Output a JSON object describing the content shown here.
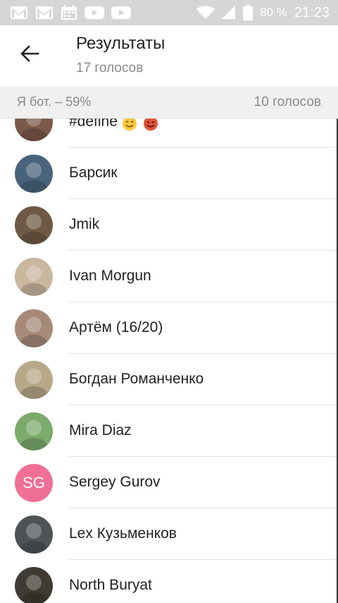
{
  "status_bar": {
    "icons": [
      "gmail-icon",
      "gmail-icon",
      "calendar-icon",
      "youtube-icon",
      "youtube-icon"
    ],
    "battery_percent": "80 %",
    "time": "21:23"
  },
  "header": {
    "title": "Результаты",
    "subtitle": "17 голосов"
  },
  "section": {
    "option_label": "Я бот. – 59%",
    "votes": "10 голосов"
  },
  "voters": [
    {
      "name": "#define",
      "emoji": [
        "smiling-halo-emoji",
        "smiling-devil-emoji"
      ],
      "avatar": {
        "type": "photo",
        "color": "#7b5a4a"
      }
    },
    {
      "name": "Барсик",
      "avatar": {
        "type": "photo",
        "color": "#49637a"
      }
    },
    {
      "name": "Jmik",
      "avatar": {
        "type": "photo",
        "color": "#6e5a44"
      }
    },
    {
      "name": "Ivan Morgun",
      "avatar": {
        "type": "photo",
        "color": "#c9b7a0"
      }
    },
    {
      "name": "Артём (16/20)",
      "avatar": {
        "type": "photo",
        "color": "#a58a78"
      }
    },
    {
      "name": "Богдан Романченко",
      "avatar": {
        "type": "photo",
        "color": "#b8a88a"
      }
    },
    {
      "name": "Mira Diaz",
      "avatar": {
        "type": "photo",
        "color": "#7cab6d"
      }
    },
    {
      "name": "Sergey Gurov",
      "avatar": {
        "type": "initials",
        "initials": "SG",
        "color": "#ef6f96"
      }
    },
    {
      "name": "Lex Кузьменков",
      "avatar": {
        "type": "photo",
        "color": "#4f5356"
      }
    },
    {
      "name": "North Buryat",
      "avatar": {
        "type": "photo",
        "color": "#3f3a33"
      }
    }
  ]
}
